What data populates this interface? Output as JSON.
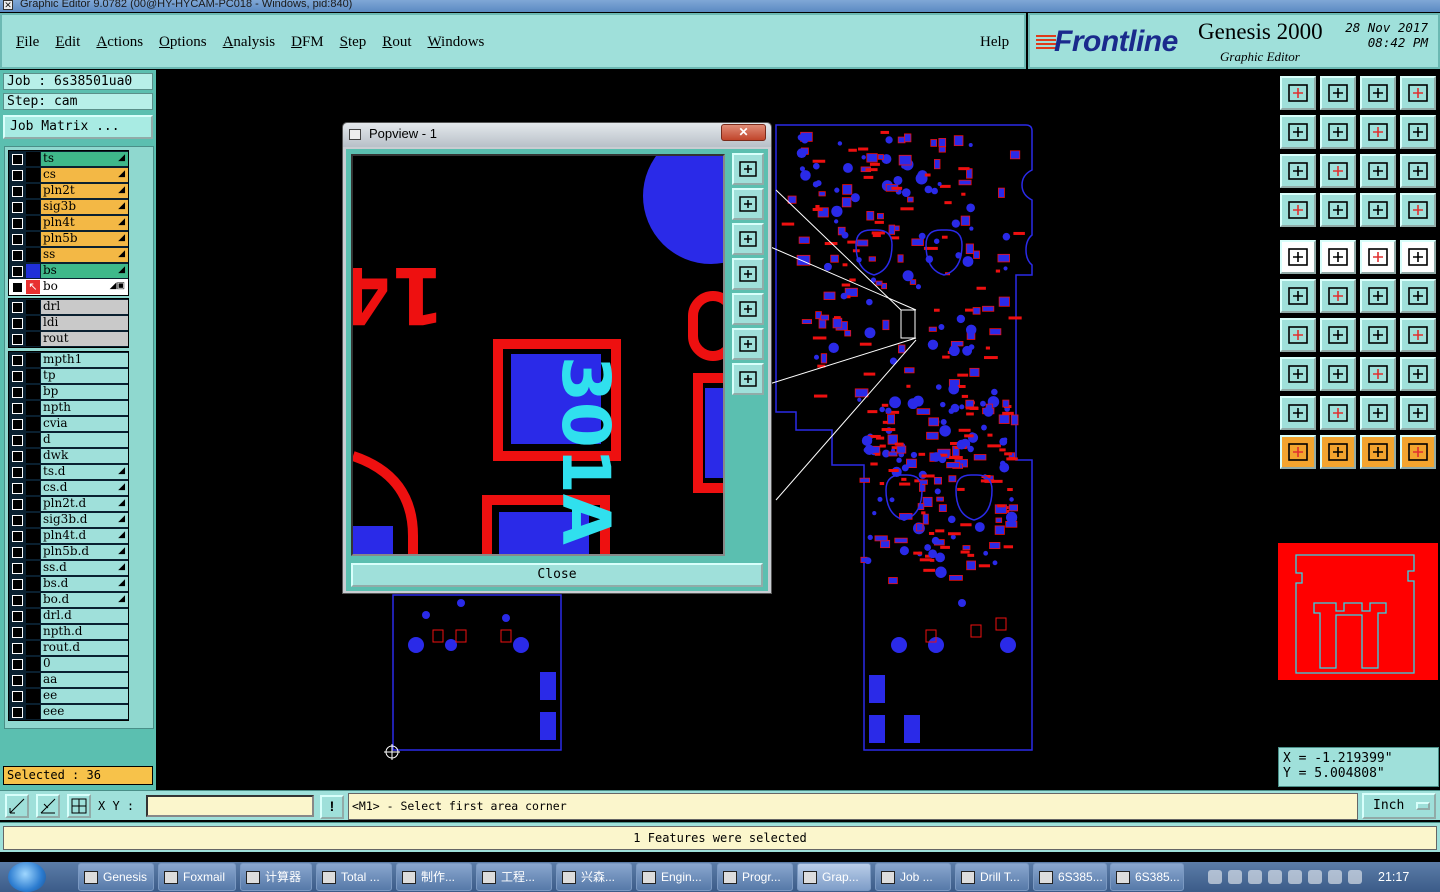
{
  "window": {
    "title": "Graphic Editor 9.0782 (00@HY-HYCAM-PC018 - Windows, pid:840)"
  },
  "menu": {
    "items": [
      "File",
      "Edit",
      "Actions",
      "Options",
      "Analysis",
      "DFM",
      "Step",
      "Rout",
      "Windows"
    ],
    "help": "Help"
  },
  "brand": {
    "logo": "Frontline",
    "product": "Genesis 2000",
    "subtitle": "Graphic Editor",
    "date": "28 Nov 2017",
    "time": "08:42 PM"
  },
  "job": {
    "job_label": "Job : 6s38501ua0",
    "step_label": "Step: cam",
    "matrix_button": "Job Matrix ..."
  },
  "layers": {
    "group1": [
      {
        "name": "ts",
        "color": "#3fb88a",
        "swatch": "#000",
        "tag": "◢"
      },
      {
        "name": "cs",
        "color": "#f3b845",
        "swatch": "#000",
        "tag": "◢"
      },
      {
        "name": "pln2t",
        "color": "#f3b845",
        "swatch": "#000",
        "tag": "◢"
      },
      {
        "name": "sig3b",
        "color": "#f3b845",
        "swatch": "#000",
        "tag": "◢"
      },
      {
        "name": "pln4t",
        "color": "#f3b845",
        "swatch": "#000",
        "tag": "◢"
      },
      {
        "name": "pln5b",
        "color": "#f3b845",
        "swatch": "#000",
        "tag": "◢"
      },
      {
        "name": "ss",
        "color": "#f3b845",
        "swatch": "#000",
        "tag": "◢"
      },
      {
        "name": "bs",
        "color": "#3fb88a",
        "swatch": "#2030d8",
        "tag": "◢"
      },
      {
        "name": "bo",
        "color": "#ffffff",
        "swatch": "#e83030",
        "tag": "◢▣"
      }
    ],
    "group2": [
      {
        "name": "drl",
        "color": "#c9c9c9",
        "swatch": "#000",
        "tag": ""
      },
      {
        "name": "ldi",
        "color": "#c9c9c9",
        "swatch": "#000",
        "tag": ""
      },
      {
        "name": "rout",
        "color": "#c9c9c9",
        "swatch": "#000",
        "tag": ""
      }
    ],
    "group3": [
      {
        "name": "mpth1",
        "tag": ""
      },
      {
        "name": "tp",
        "tag": ""
      },
      {
        "name": "bp",
        "tag": ""
      },
      {
        "name": "npth",
        "tag": ""
      },
      {
        "name": "cvia",
        "tag": ""
      },
      {
        "name": "d",
        "tag": ""
      },
      {
        "name": "dwk",
        "tag": ""
      },
      {
        "name": "ts.d",
        "tag": "◢"
      },
      {
        "name": "cs.d",
        "tag": "◢"
      },
      {
        "name": "pln2t.d",
        "tag": "◢"
      },
      {
        "name": "sig3b.d",
        "tag": "◢"
      },
      {
        "name": "pln4t.d",
        "tag": "◢"
      },
      {
        "name": "pln5b.d",
        "tag": "◢"
      },
      {
        "name": "ss.d",
        "tag": "◢"
      },
      {
        "name": "bs.d",
        "tag": "◢"
      },
      {
        "name": "bo.d",
        "tag": "◢"
      },
      {
        "name": "drl.d",
        "tag": ""
      },
      {
        "name": "npth.d",
        "tag": ""
      },
      {
        "name": "rout.d",
        "tag": ""
      },
      {
        "name": "0",
        "tag": ""
      },
      {
        "name": "aa",
        "tag": ""
      },
      {
        "name": "ee",
        "tag": ""
      },
      {
        "name": "eee",
        "tag": ""
      }
    ]
  },
  "selected": "Selected : 36",
  "popview": {
    "title": "Popview - 1",
    "close_button": "Close",
    "board_text_1": "141",
    "board_text_2": "301A"
  },
  "coords": {
    "x": "X  = -1.219399\"",
    "y": "Y  = 5.004808\""
  },
  "command": {
    "xy_label": "X Y :",
    "xy_value": "",
    "prompt": "<M1> - Select first area corner",
    "unit": "Inch"
  },
  "status": "1 Features were selected",
  "taskbar": {
    "items": [
      "Genesis",
      "Foxmail",
      "计算器",
      "Total ...",
      "制作...",
      "工程...",
      "兴森...",
      "Engin...",
      "Progr...",
      "Grap...",
      "Job ...",
      "Drill T...",
      "6S385...",
      "6S385..."
    ],
    "clock": "21:17"
  },
  "colors": {
    "accent": "#9fe0da",
    "panel": "#5bbfb0",
    "copper_blue": "#2a2ae8",
    "silk_red": "#ee1010"
  }
}
